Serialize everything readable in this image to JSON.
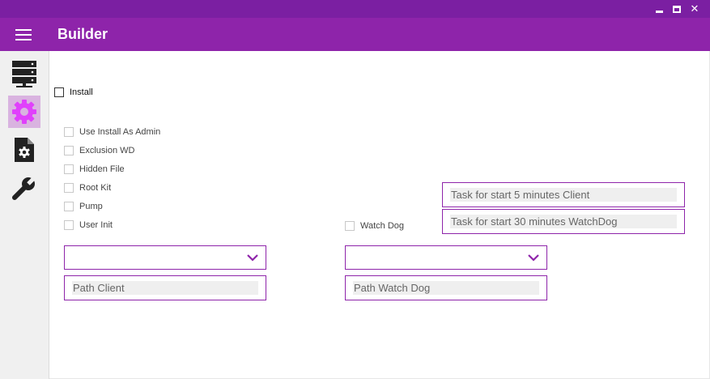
{
  "app": {
    "title": "Builder"
  },
  "colors": {
    "titlebar": "#7b1fa2",
    "appbar": "#8e24aa",
    "accent": "#8e24aa",
    "sidebar_active": "#d9b3e0"
  },
  "window_controls": {
    "minimize_icon": "minimize-icon",
    "maximize_icon": "maximize-icon",
    "close_glyph": "✕"
  },
  "sidebar": {
    "items": [
      {
        "icon": "server-icon",
        "active": false
      },
      {
        "icon": "gear-icon",
        "active": true
      },
      {
        "icon": "settings-file-icon",
        "active": false
      },
      {
        "icon": "wrench-icon",
        "active": false
      }
    ]
  },
  "install": {
    "label": "Install",
    "checked": false
  },
  "options": [
    {
      "label": "Use Install As Admin",
      "checked": false
    },
    {
      "label": "Exclusion WD",
      "checked": false
    },
    {
      "label": "Hidden File",
      "checked": false
    },
    {
      "label": "Root Kit",
      "checked": false
    },
    {
      "label": "Pump",
      "checked": false
    },
    {
      "label": "User Init",
      "checked": false
    }
  ],
  "watchdog": {
    "label": "Watch Dog",
    "checked": false
  },
  "client_combo": {
    "value": ""
  },
  "watchdog_combo": {
    "value": ""
  },
  "fields": {
    "path_client": "Path Client",
    "path_watchdog": "Path Watch Dog",
    "task_client": "Task for start 5 minutes Client",
    "task_watchdog": "Task for start 30 minutes WatchDog"
  }
}
